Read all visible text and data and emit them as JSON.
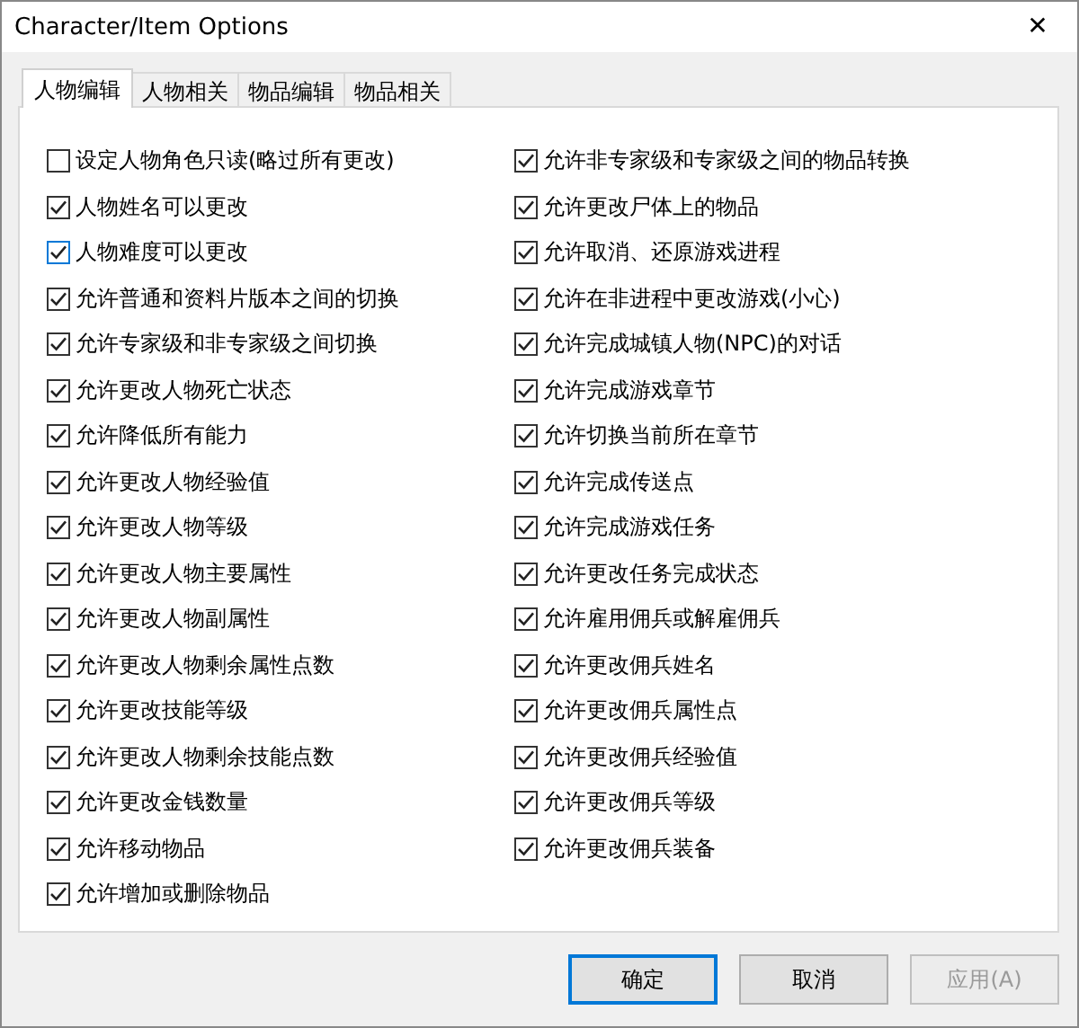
{
  "window": {
    "title": "Character/Item Options",
    "close": "✕"
  },
  "tabs": [
    {
      "label": "人物编辑",
      "selected": true
    },
    {
      "label": "人物相关",
      "selected": false
    },
    {
      "label": "物品编辑",
      "selected": false
    },
    {
      "label": "物品相关",
      "selected": false
    }
  ],
  "left_options": [
    {
      "label": "设定人物角色只读(略过所有更改)",
      "checked": false,
      "focused": false
    },
    {
      "label": "人物姓名可以更改",
      "checked": true,
      "focused": false
    },
    {
      "label": "人物难度可以更改",
      "checked": true,
      "focused": true
    },
    {
      "label": "允许普通和资料片版本之间的切换",
      "checked": true,
      "focused": false
    },
    {
      "label": "允许专家级和非专家级之间切换",
      "checked": true,
      "focused": false
    },
    {
      "label": "允许更改人物死亡状态",
      "checked": true,
      "focused": false
    },
    {
      "label": "允许降低所有能力",
      "checked": true,
      "focused": false
    },
    {
      "label": "允许更改人物经验值",
      "checked": true,
      "focused": false
    },
    {
      "label": "允许更改人物等级",
      "checked": true,
      "focused": false
    },
    {
      "label": "允许更改人物主要属性",
      "checked": true,
      "focused": false
    },
    {
      "label": "允许更改人物副属性",
      "checked": true,
      "focused": false
    },
    {
      "label": "允许更改人物剩余属性点数",
      "checked": true,
      "focused": false
    },
    {
      "label": "允许更改技能等级",
      "checked": true,
      "focused": false
    },
    {
      "label": "允许更改人物剩余技能点数",
      "checked": true,
      "focused": false
    },
    {
      "label": "允许更改金钱数量",
      "checked": true,
      "focused": false
    },
    {
      "label": "允许移动物品",
      "checked": true,
      "focused": false
    },
    {
      "label": "允许增加或删除物品",
      "checked": true,
      "focused": false
    }
  ],
  "right_options": [
    {
      "label": "允许非专家级和专家级之间的物品转换",
      "checked": true,
      "focused": false
    },
    {
      "label": "允许更改尸体上的物品",
      "checked": true,
      "focused": false
    },
    {
      "label": "允许取消、还原游戏进程",
      "checked": true,
      "focused": false
    },
    {
      "label": "允许在非进程中更改游戏(小心)",
      "checked": true,
      "focused": false
    },
    {
      "label": "允许完成城镇人物(NPC)的对话",
      "checked": true,
      "focused": false
    },
    {
      "label": "允许完成游戏章节",
      "checked": true,
      "focused": false
    },
    {
      "label": "允许切换当前所在章节",
      "checked": true,
      "focused": false
    },
    {
      "label": "允许完成传送点",
      "checked": true,
      "focused": false
    },
    {
      "label": "允许完成游戏任务",
      "checked": true,
      "focused": false
    },
    {
      "label": "允许更改任务完成状态",
      "checked": true,
      "focused": false
    },
    {
      "label": "允许雇用佣兵或解雇佣兵",
      "checked": true,
      "focused": false
    },
    {
      "label": "允许更改佣兵姓名",
      "checked": true,
      "focused": false
    },
    {
      "label": "允许更改佣兵属性点",
      "checked": true,
      "focused": false
    },
    {
      "label": "允许更改佣兵经验值",
      "checked": true,
      "focused": false
    },
    {
      "label": "允许更改佣兵等级",
      "checked": true,
      "focused": false
    },
    {
      "label": "允许更改佣兵装备",
      "checked": true,
      "focused": false
    }
  ],
  "buttons": [
    {
      "label": "确定",
      "default": true,
      "disabled": false
    },
    {
      "label": "取消",
      "default": false,
      "disabled": false
    },
    {
      "label": "应用(A)",
      "default": false,
      "disabled": true
    }
  ]
}
